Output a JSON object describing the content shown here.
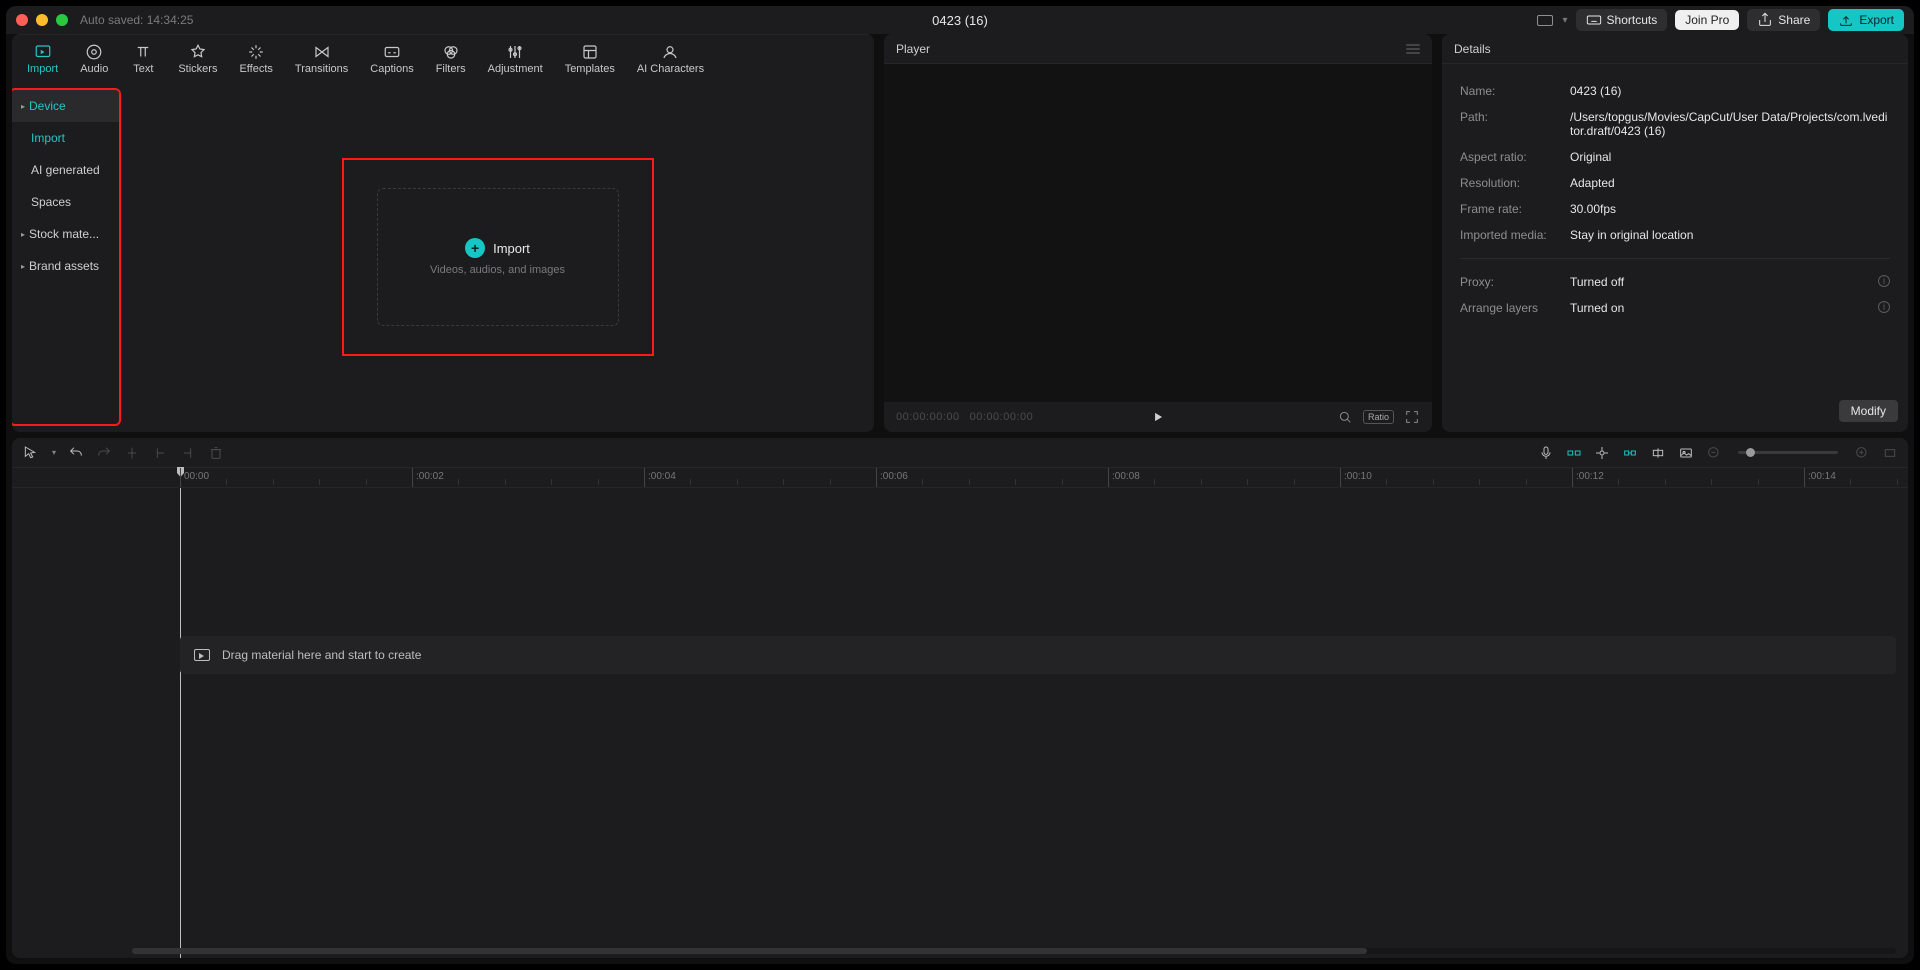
{
  "titlebar": {
    "autosave": "Auto saved: 14:34:25",
    "title": "0423 (16)",
    "shortcuts": "Shortcuts",
    "join_pro": "Join Pro",
    "share": "Share",
    "export": "Export"
  },
  "tabs": [
    {
      "id": "import",
      "label": "Import"
    },
    {
      "id": "audio",
      "label": "Audio"
    },
    {
      "id": "text",
      "label": "Text"
    },
    {
      "id": "stickers",
      "label": "Stickers"
    },
    {
      "id": "effects",
      "label": "Effects"
    },
    {
      "id": "transitions",
      "label": "Transitions"
    },
    {
      "id": "captions",
      "label": "Captions"
    },
    {
      "id": "filters",
      "label": "Filters"
    },
    {
      "id": "adjustment",
      "label": "Adjustment"
    },
    {
      "id": "templates",
      "label": "Templates"
    },
    {
      "id": "ai",
      "label": "AI Characters"
    }
  ],
  "sidebar": {
    "device": "Device",
    "import": "Import",
    "ai_generated": "AI generated",
    "spaces": "Spaces",
    "stock": "Stock mate...",
    "brand": "Brand assets"
  },
  "import_card": {
    "label": "Import",
    "sub": "Videos, audios, and images"
  },
  "player": {
    "title": "Player",
    "time_current": "00:00:00:00",
    "time_total": "00:00:00:00",
    "ratio": "Ratio"
  },
  "details": {
    "title": "Details",
    "rows": {
      "name_label": "Name:",
      "name_val": "0423 (16)",
      "path_label": "Path:",
      "path_val": "/Users/topgus/Movies/CapCut/User Data/Projects/com.lveditor.draft/0423 (16)",
      "aspect_label": "Aspect ratio:",
      "aspect_val": "Original",
      "res_label": "Resolution:",
      "res_val": "Adapted",
      "fr_label": "Frame rate:",
      "fr_val": "30.00fps",
      "imp_label": "Imported media:",
      "imp_val": "Stay in original location",
      "proxy_label": "Proxy:",
      "proxy_val": "Turned off",
      "arrange_label": "Arrange layers",
      "arrange_val": "Turned on"
    },
    "modify": "Modify"
  },
  "timeline": {
    "ticks": [
      "00:00",
      ":00:02",
      ":00:04",
      ":00:06",
      ":00:08",
      ":00:10",
      ":00:12",
      ":00:14"
    ],
    "drag_hint": "Drag material here and start to create"
  }
}
